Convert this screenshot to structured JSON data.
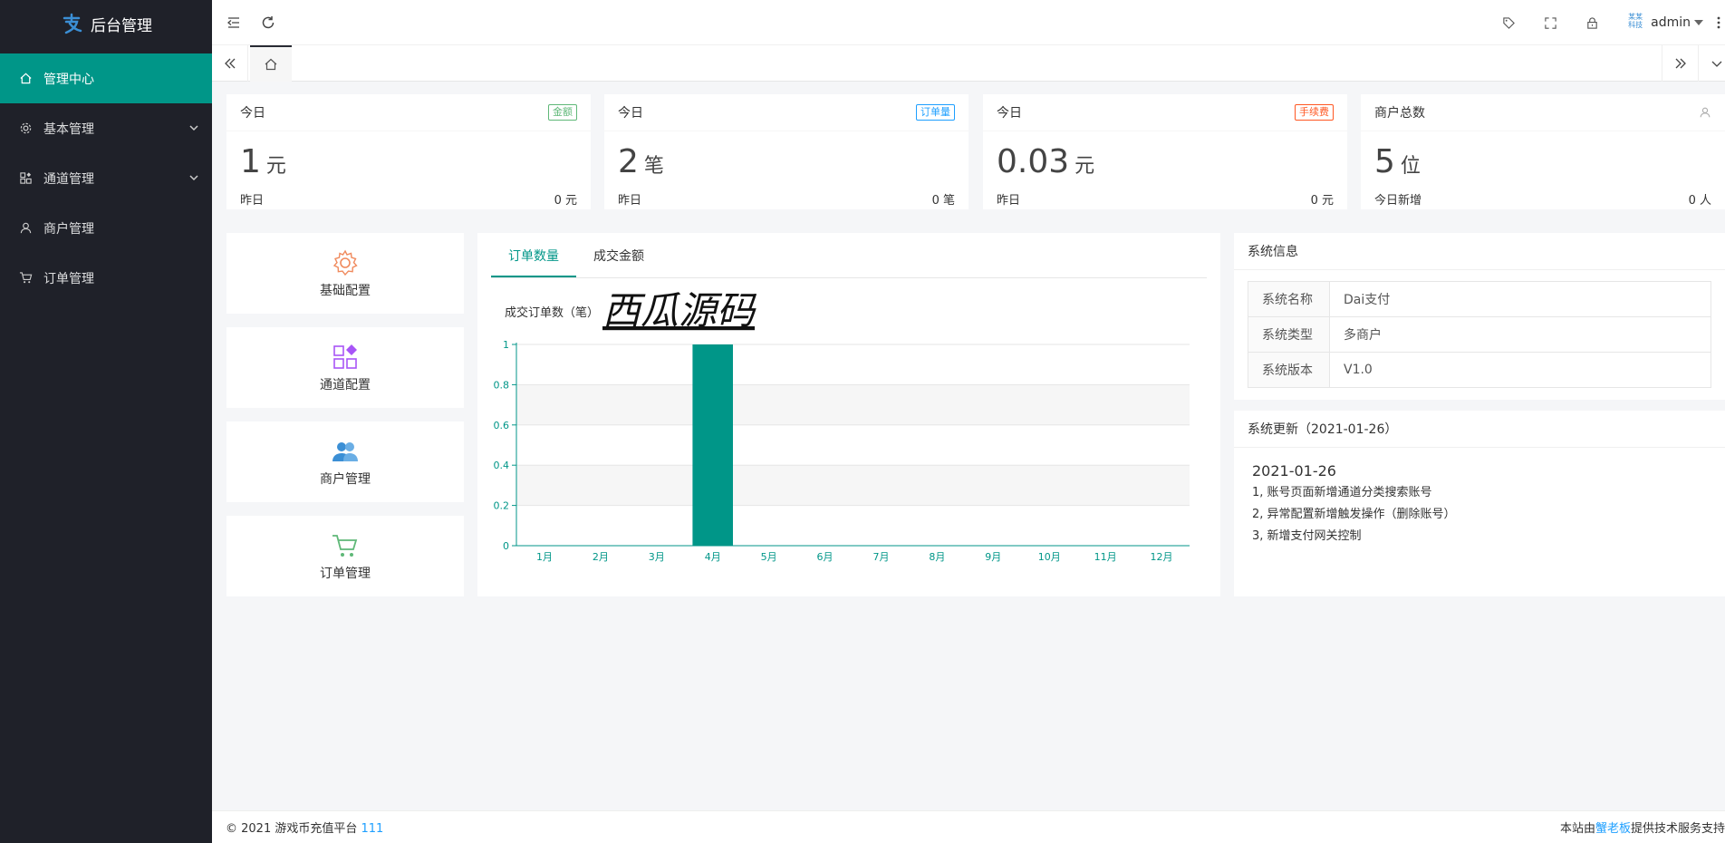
{
  "sidebar": {
    "title": "后台管理",
    "items": [
      {
        "label": "管理中心",
        "icon": "home-icon"
      },
      {
        "label": "基本管理",
        "icon": "gear-icon"
      },
      {
        "label": "通道管理",
        "icon": "apps-icon"
      },
      {
        "label": "商户管理",
        "icon": "user-icon"
      },
      {
        "label": "订单管理",
        "icon": "cart-icon"
      }
    ]
  },
  "header": {
    "user": "admin",
    "avatar_text_line1": "某某",
    "avatar_text_line2": "科技"
  },
  "stats": [
    {
      "head": "今日",
      "badge": "金额",
      "badge_color": "#5fb878",
      "value": "1",
      "unit": "元",
      "foot_label": "昨日",
      "foot_value": "0 元"
    },
    {
      "head": "今日",
      "badge": "订单量",
      "badge_color": "#1e9fff",
      "value": "2",
      "unit": "笔",
      "foot_label": "昨日",
      "foot_value": "0 笔"
    },
    {
      "head": "今日",
      "badge": "手续费",
      "badge_color": "#ff5722",
      "value": "0.03",
      "unit": "元",
      "foot_label": "昨日",
      "foot_value": "0 元"
    },
    {
      "head": "商户总数",
      "badge": "",
      "badge_color": "",
      "value": "5",
      "unit": "位",
      "foot_label": "今日新增",
      "foot_value": "0 人"
    }
  ],
  "shortcuts": [
    {
      "label": "基础配置",
      "icon": "gear-icon",
      "color": "#f08a5d"
    },
    {
      "label": "通道配置",
      "icon": "apps-icon",
      "color": "#a855f7"
    },
    {
      "label": "商户管理",
      "icon": "users-icon",
      "color": "#3b8fd5"
    },
    {
      "label": "订单管理",
      "icon": "cart-icon",
      "color": "#5fb878"
    }
  ],
  "chart_tabs": [
    "订单数量",
    "成交金额"
  ],
  "chart_data": {
    "type": "bar",
    "title": "成交订单数（笔）",
    "watermark": "西瓜源码",
    "categories": [
      "1月",
      "2月",
      "3月",
      "4月",
      "5月",
      "6月",
      "7月",
      "8月",
      "9月",
      "10月",
      "11月",
      "12月"
    ],
    "values": [
      0,
      0,
      0,
      1,
      0,
      0,
      0,
      0,
      0,
      0,
      0,
      0
    ],
    "ylim": [
      0,
      1
    ],
    "yticks": [
      0,
      0.2,
      0.4,
      0.6,
      0.8,
      1
    ],
    "color": "#009688"
  },
  "sysinfo": {
    "title": "系统信息",
    "rows": [
      {
        "k": "系统名称",
        "v": "Dai支付"
      },
      {
        "k": "系统类型",
        "v": "多商户"
      },
      {
        "k": "系统版本",
        "v": "V1.0"
      }
    ]
  },
  "update": {
    "title": "系统更新（2021-01-26）",
    "date": "2021-01-26",
    "lines": [
      "1, 账号页面新增通道分类搜索账号",
      "2, 异常配置新增触发操作（删除账号）",
      "3, 新增支付网关控制"
    ]
  },
  "footer": {
    "left_text": "© 2021 游戏币充值平台",
    "left_link": "111",
    "right_pre": "本站由",
    "right_link": "蟹老板",
    "right_post": "提供技术服务支持"
  }
}
